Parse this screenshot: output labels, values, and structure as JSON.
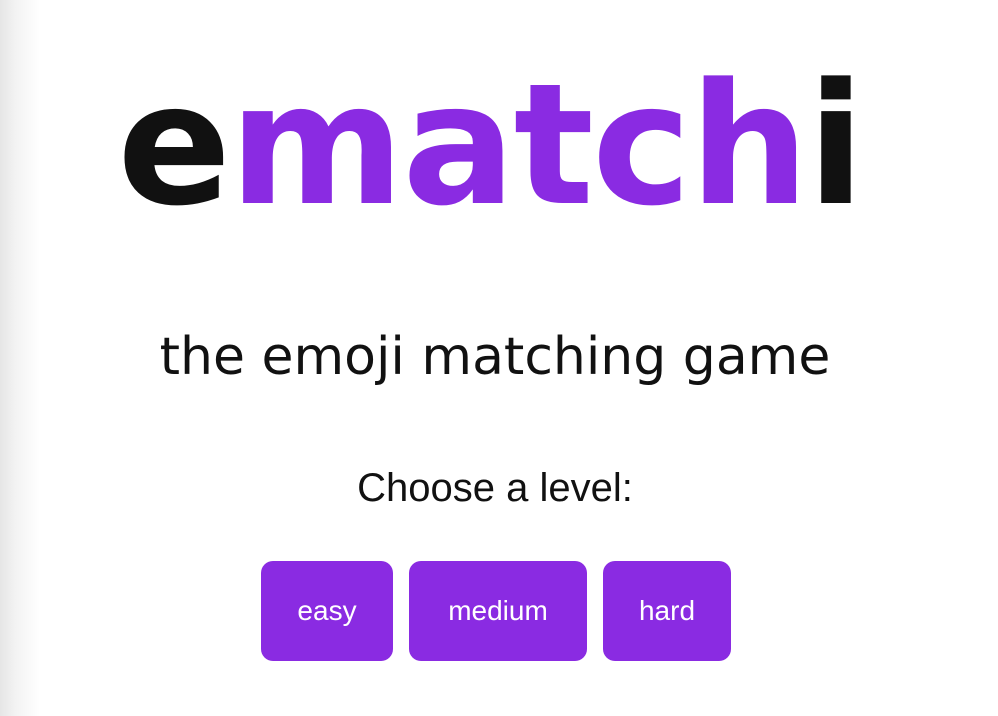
{
  "logo": {
    "part1": "e",
    "part2": "match",
    "part3": "i"
  },
  "subtitle": "the emoji matching game",
  "prompt": "Choose a level:",
  "levels": [
    {
      "label": "easy"
    },
    {
      "label": "medium"
    },
    {
      "label": "hard"
    }
  ],
  "colors": {
    "accent": "#8a2be2",
    "text": "#111111",
    "background": "#ffffff"
  }
}
